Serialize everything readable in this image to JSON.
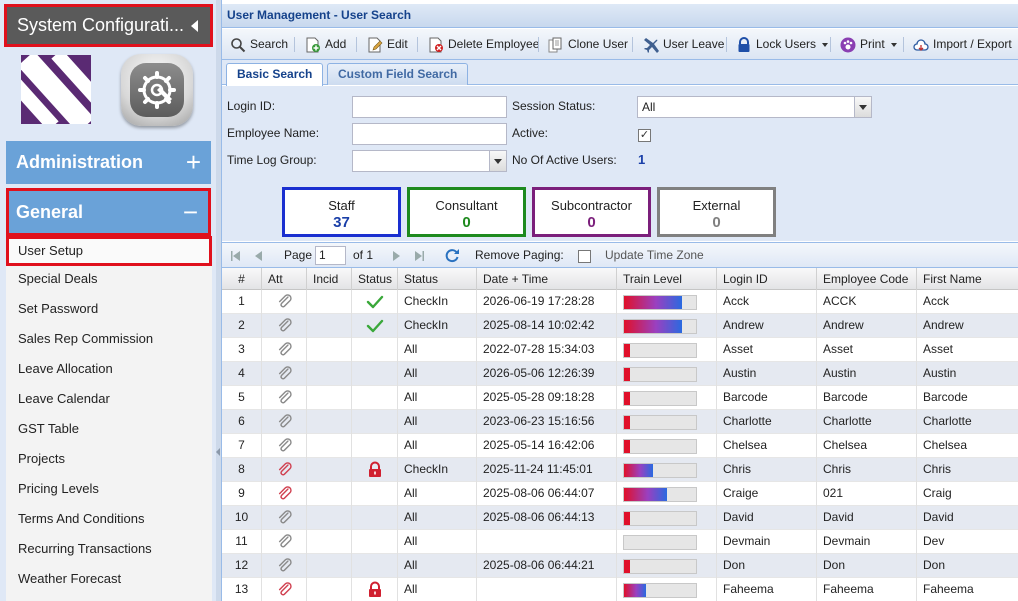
{
  "sidebar": {
    "header_title": "System Configurati...",
    "admin_label": "Administration",
    "general_label": "General",
    "menu": [
      "User Setup",
      "Special Deals",
      "Set Password",
      "Sales Rep Commission",
      "Leave Allocation",
      "Leave Calendar",
      "GST Table",
      "Projects",
      "Pricing Levels",
      "Terms And Conditions",
      "Recurring Transactions",
      "Weather Forecast"
    ]
  },
  "main": {
    "title": "User Management - User Search",
    "toolbar": [
      "Search",
      "Add",
      "Edit",
      "Delete Employee",
      "Clone User",
      "User Leave",
      "Lock Users",
      "Print",
      "Import / Export"
    ],
    "tabs": [
      "Basic Search",
      "Custom Field Search"
    ],
    "form": {
      "login_id": "Login ID:",
      "employee_name": "Employee Name:",
      "time_log_group": "Time Log Group:",
      "session_status": "Session Status:",
      "session_value": "All",
      "active": "Active:",
      "active_check": "✓",
      "no_active_users": "No Of Active Users:",
      "active_count": "1"
    },
    "categories": [
      {
        "name": "Staff",
        "count": "37",
        "color": "#1a2fd0",
        "count_color": "#1a3fa8"
      },
      {
        "name": "Consultant",
        "count": "0",
        "color": "#1e8a1e",
        "count_color": "#1e8a1e"
      },
      {
        "name": "Subcontractor",
        "count": "0",
        "color": "#7b1f7b",
        "count_color": "#7b1f7b"
      },
      {
        "name": "External",
        "count": "0",
        "color": "#808080",
        "count_color": "#808080"
      }
    ],
    "paging": {
      "page_label": "Page",
      "page_value": "1",
      "of_label": "of 1",
      "remove_paging": "Remove Paging:",
      "update_tz": "Update Time Zone"
    },
    "columns": [
      "#",
      "Att",
      "Incid",
      "Status",
      "Status",
      "Date + Time",
      "Train Level",
      "Login ID",
      "Employee Code",
      "First Name"
    ],
    "rows": [
      {
        "n": "1",
        "att": "grey",
        "status_icon": "tick",
        "status": "CheckIn",
        "dt": "2026-06-19 17:28:28",
        "train": 0.8,
        "login": "Acck",
        "code": "ACCK",
        "first": "Acck"
      },
      {
        "n": "2",
        "att": "grey",
        "status_icon": "tick",
        "status": "CheckIn",
        "dt": "2025-08-14 10:02:42",
        "train": 0.8,
        "login": "Andrew",
        "code": "Andrew",
        "first": "Andrew"
      },
      {
        "n": "3",
        "att": "grey",
        "status_icon": "",
        "status": "All",
        "dt": "2022-07-28 15:34:03",
        "train": 0.08,
        "login": "Asset",
        "code": "Asset",
        "first": "Asset"
      },
      {
        "n": "4",
        "att": "grey",
        "status_icon": "",
        "status": "All",
        "dt": "2026-05-06 12:26:39",
        "train": 0.08,
        "login": "Austin",
        "code": "Austin",
        "first": "Austin"
      },
      {
        "n": "5",
        "att": "grey",
        "status_icon": "",
        "status": "All",
        "dt": "2025-05-28 09:18:28",
        "train": 0.08,
        "login": "Barcode",
        "code": "Barcode",
        "first": "Barcode"
      },
      {
        "n": "6",
        "att": "grey",
        "status_icon": "",
        "status": "All",
        "dt": "2023-06-23 15:16:56",
        "train": 0.08,
        "login": "Charlotte",
        "code": "Charlotte",
        "first": "Charlotte"
      },
      {
        "n": "7",
        "att": "grey",
        "status_icon": "",
        "status": "All",
        "dt": "2025-05-14 16:42:06",
        "train": 0.08,
        "login": "Chelsea",
        "code": "Chelsea",
        "first": "Chelsea"
      },
      {
        "n": "8",
        "att": "red",
        "status_icon": "lock",
        "status": "CheckIn",
        "dt": "2025-11-24 11:45:01",
        "train": 0.4,
        "login": "Chris",
        "code": "Chris",
        "first": "Chris"
      },
      {
        "n": "9",
        "att": "red",
        "status_icon": "",
        "status": "All",
        "dt": "2025-08-06 06:44:07",
        "train": 0.6,
        "login": "Craige",
        "code": "021",
        "first": "Craig"
      },
      {
        "n": "10",
        "att": "grey",
        "status_icon": "",
        "status": "All",
        "dt": "2025-08-06 06:44:13",
        "train": 0.08,
        "login": "David",
        "code": "David",
        "first": "David"
      },
      {
        "n": "11",
        "att": "grey",
        "status_icon": "",
        "status": "All",
        "dt": "",
        "train": 0,
        "login": "Devmain",
        "code": "Devmain",
        "first": "Dev"
      },
      {
        "n": "12",
        "att": "grey",
        "status_icon": "",
        "status": "All",
        "dt": "2025-08-06 06:44:21",
        "train": 0.08,
        "login": "Don",
        "code": "Don",
        "first": "Don"
      },
      {
        "n": "13",
        "att": "red",
        "status_icon": "lock",
        "status": "All",
        "dt": "",
        "train": 0.3,
        "login": "Faheema",
        "code": "Faheema",
        "first": "Faheema"
      }
    ]
  }
}
